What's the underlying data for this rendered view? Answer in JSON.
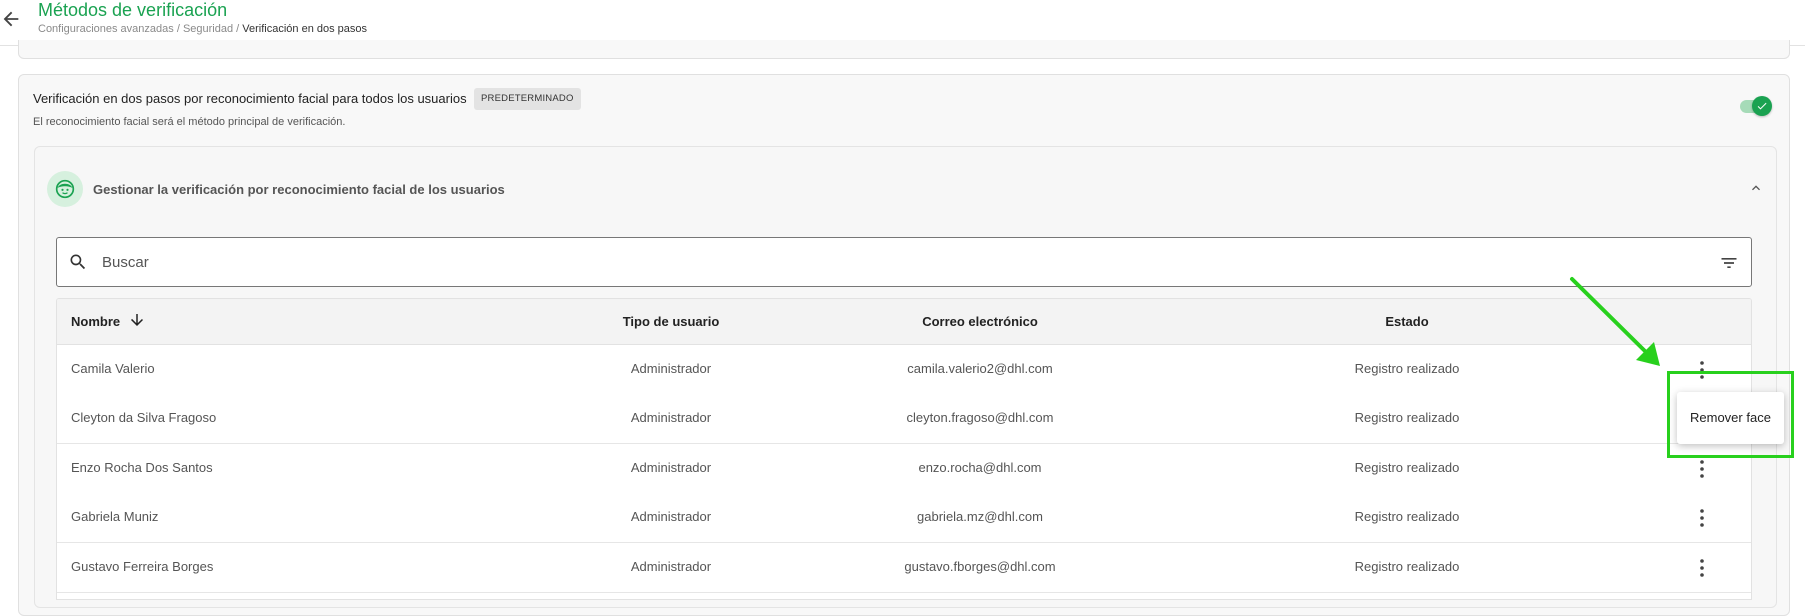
{
  "header": {
    "title": "Métodos de verificación",
    "breadcrumb": {
      "item1": "Configuraciones avanzadas",
      "sep1": " / ",
      "item2": "Seguridad",
      "sep2": " / ",
      "current": "Verificación en dos pasos"
    }
  },
  "section": {
    "title": "Verificación en dos pasos por reconocimiento facial para todos los usuarios",
    "badge": "PREDETERMINADO",
    "subtitle": "El reconocimiento facial será el método principal de verificación.",
    "toggle_on": true
  },
  "manage": {
    "title": "Gestionar la verificación por reconocimiento facial de los usuarios"
  },
  "search": {
    "placeholder": "Buscar",
    "value": ""
  },
  "table": {
    "columns": {
      "name": "Nombre",
      "type": "Tipo de usuario",
      "email": "Correo electrónico",
      "status": "Estado"
    },
    "rows": [
      {
        "name": "Camila Valerio",
        "type": "Administrador",
        "email": "camila.valerio2@dhl.com",
        "status": "Registro realizado"
      },
      {
        "name": "Cleyton da Silva Fragoso",
        "type": "Administrador",
        "email": "cleyton.fragoso@dhl.com",
        "status": "Registro realizado"
      },
      {
        "name": "Enzo Rocha Dos Santos",
        "type": "Administrador",
        "email": "enzo.rocha@dhl.com",
        "status": "Registro realizado"
      },
      {
        "name": "Gabriela Muniz",
        "type": "Administrador",
        "email": "gabriela.mz@dhl.com",
        "status": "Registro realizado"
      },
      {
        "name": "Gustavo Ferreira Borges",
        "type": "Administrador",
        "email": "gustavo.fborges@dhl.com",
        "status": "Registro realizado"
      }
    ]
  },
  "menu": {
    "remove_face": "Remover face"
  },
  "colors": {
    "accent": "#1aa251",
    "annotation": "#28d01d"
  }
}
